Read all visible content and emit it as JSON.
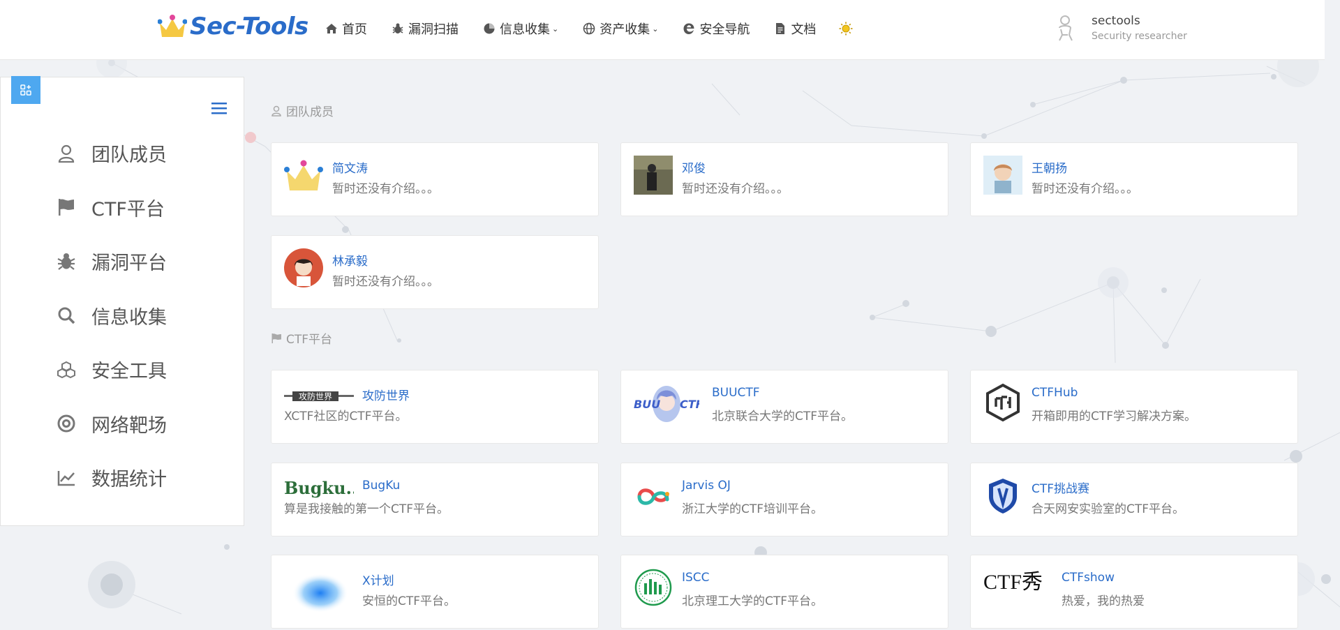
{
  "header": {
    "logo_text": "Sec-Tools",
    "nav": [
      {
        "label": "首页",
        "icon": "home-icon"
      },
      {
        "label": "漏洞扫描",
        "icon": "bug-icon"
      },
      {
        "label": "信息收集",
        "icon": "globe-pie-icon",
        "dropdown": true
      },
      {
        "label": "资产收集",
        "icon": "globe-icon",
        "dropdown": true
      },
      {
        "label": "安全导航",
        "icon": "edge-icon"
      },
      {
        "label": "文档",
        "icon": "document-icon"
      }
    ],
    "theme_icon": "sun-icon",
    "user": {
      "name": "sectools",
      "role": "Security researcher"
    }
  },
  "sidebar": {
    "items": [
      {
        "label": "团队成员",
        "icon": "user-icon"
      },
      {
        "label": "CTF平台",
        "icon": "flag-icon"
      },
      {
        "label": "漏洞平台",
        "icon": "bug-icon"
      },
      {
        "label": "信息收集",
        "icon": "search-icon"
      },
      {
        "label": "安全工具",
        "icon": "cubes-icon"
      },
      {
        "label": "网络靶场",
        "icon": "target-icon"
      },
      {
        "label": "数据统计",
        "icon": "chart-icon"
      }
    ]
  },
  "sections": {
    "team": {
      "title": "团队成员",
      "members": [
        {
          "name": "简文涛",
          "desc": "暂时还没有介绍。。。"
        },
        {
          "name": "邓俊",
          "desc": "暂时还没有介绍。。。"
        },
        {
          "name": "王朝扬",
          "desc": "暂时还没有介绍。。。"
        },
        {
          "name": "林承毅",
          "desc": "暂时还没有介绍。。。"
        }
      ]
    },
    "ctf": {
      "title": "CTF平台",
      "sites": [
        {
          "name": "攻防世界",
          "desc": "XCTF社区的CTF平台。"
        },
        {
          "name": "BUUCTF",
          "desc": "北京联合大学的CTF平台。"
        },
        {
          "name": "CTFHub",
          "desc": "开箱即用的CTF学习解决方案。"
        },
        {
          "name": "BugKu",
          "desc": "算是我接触的第一个CTF平台。"
        },
        {
          "name": "Jarvis OJ",
          "desc": "浙江大学的CTF培训平台。"
        },
        {
          "name": "CTF挑战赛",
          "desc": "合天网安实验室的CTF平台。"
        },
        {
          "name": "X计划",
          "desc": "安恒的CTF平台。"
        },
        {
          "name": "ISCC",
          "desc": "北京理工大学的CTF平台。"
        },
        {
          "name": "CTFshow",
          "desc": "热爱，我的热爱"
        }
      ]
    }
  },
  "logo_texts": {
    "buuctf_logo": "BUU CTF",
    "bugku_logo": "Bugku...",
    "ctfshow_logo": "CTF秀",
    "xctf_logo": "攻防世界"
  },
  "colors": {
    "accent": "#2a6cc9",
    "toggle": "#4ea8f0",
    "background": "#f0f2f5"
  }
}
